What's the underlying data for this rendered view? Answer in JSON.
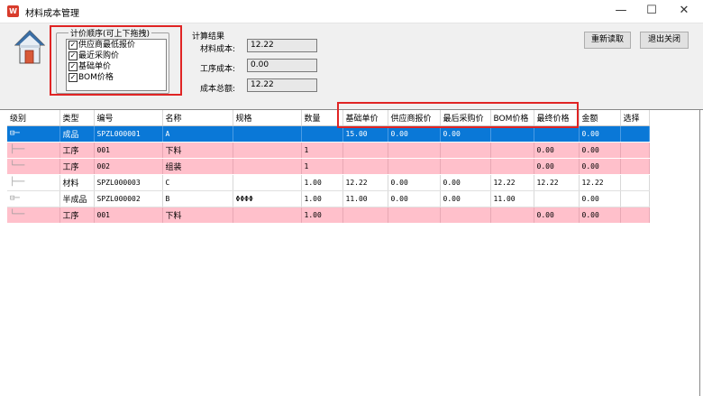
{
  "window": {
    "icon_label": "W",
    "title": "材料成本管理",
    "min_glyph": "—",
    "max_glyph": "☐",
    "close_glyph": "✕"
  },
  "order_panel": {
    "legend": "计价顺序(可上下拖拽)",
    "items": [
      {
        "label": "供应商最低报价",
        "checked": true
      },
      {
        "label": "最近采购价",
        "checked": true
      },
      {
        "label": "基础单价",
        "checked": true
      },
      {
        "label": "BOM价格",
        "checked": true
      }
    ]
  },
  "calc": {
    "title": "计算结果",
    "material_label": "材料成本:",
    "material_value": "12.22",
    "process_label": "工序成本:",
    "process_value": "0.00",
    "total_label": "成本总额:",
    "total_value": "12.22"
  },
  "buttons": {
    "reload": "重新读取",
    "exit": "退出关闭"
  },
  "grid": {
    "columns": [
      "级别",
      "类型",
      "编号",
      "名称",
      "规格",
      "数量",
      "基础单价",
      "供应商报价",
      "最后采购价",
      "BOM价格",
      "最终价格",
      "金额",
      "选择"
    ],
    "rows": [
      {
        "tree": "⊟─",
        "type": "成品",
        "code": "SPZL000001",
        "name": "A",
        "spec": "",
        "qty": "",
        "base": "15.00",
        "supplier": "0.00",
        "last": "0.00",
        "bom": "",
        "final": "",
        "amount": "0.00",
        "select": "",
        "style": "selected"
      },
      {
        "tree": "  ├──",
        "type": "工序",
        "code": "001",
        "name": "下料",
        "spec": "",
        "qty": "1",
        "base": "",
        "supplier": "",
        "last": "",
        "bom": "",
        "final": "0.00",
        "amount": "0.00",
        "select": "",
        "style": "pink"
      },
      {
        "tree": "  └──",
        "type": "工序",
        "code": "002",
        "name": "组装",
        "spec": "",
        "qty": "1",
        "base": "",
        "supplier": "",
        "last": "",
        "bom": "",
        "final": "0.00",
        "amount": "0.00",
        "select": "",
        "style": "pink"
      },
      {
        "tree": "├──",
        "type": "材料",
        "code": "SPZL000003",
        "name": "C",
        "spec": "",
        "qty": "1.00",
        "base": "12.22",
        "supplier": "0.00",
        "last": "0.00",
        "bom": "12.22",
        "final": "12.22",
        "amount": "12.22",
        "select": "",
        "style": "white"
      },
      {
        "tree": "⊟─",
        "type": "半成品",
        "code": "SPZL000002",
        "name": "B",
        "spec": "ΦΦΦΦ",
        "qty": "1.00",
        "base": "11.00",
        "supplier": "0.00",
        "last": "0.00",
        "bom": "11.00",
        "final": "",
        "amount": "0.00",
        "select": "",
        "style": "white"
      },
      {
        "tree": "  └──",
        "type": "工序",
        "code": "001",
        "name": "下料",
        "spec": "",
        "qty": "1.00",
        "base": "",
        "supplier": "",
        "last": "",
        "bom": "",
        "final": "0.00",
        "amount": "0.00",
        "select": "",
        "style": "pink"
      }
    ]
  },
  "colors": {
    "selected": "#0a78d7",
    "pink": "#ffc0cb",
    "highlight_box": "#e02424",
    "panel": "#f0f0f0"
  }
}
